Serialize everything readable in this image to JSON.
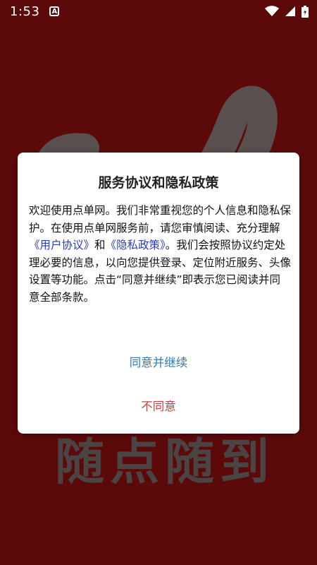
{
  "status_bar": {
    "time": "1:53",
    "notification_icon": "a-badge-icon",
    "icons": [
      "wifi-icon",
      "signal-icon",
      "battery-icon"
    ]
  },
  "background": {
    "slogan": "随点随到"
  },
  "dialog": {
    "title": "服务协议和隐私政策",
    "body": {
      "part1": "欢迎使用点单网。我们非常重视您的个人信息和隐私保护。在使用点单网服务前，请您审慎阅读、充分理解",
      "link_user": "《用户协议》",
      "and": "和",
      "link_privacy": "《隐私政策》",
      "part2": "。我们会按照协议约定处理必要的信息，以向您提供登录、定位附近服务、头像设置等功能。点击“同意并继续”即表示您已阅读并同意全部条款。"
    },
    "agree_label": "同意并继续",
    "disagree_label": "不同意"
  },
  "colors": {
    "background": "#5c0a09",
    "dialog": "#ffffff",
    "link": "#2a3db8",
    "agree": "#2a7fb7",
    "disagree": "#c34437"
  }
}
